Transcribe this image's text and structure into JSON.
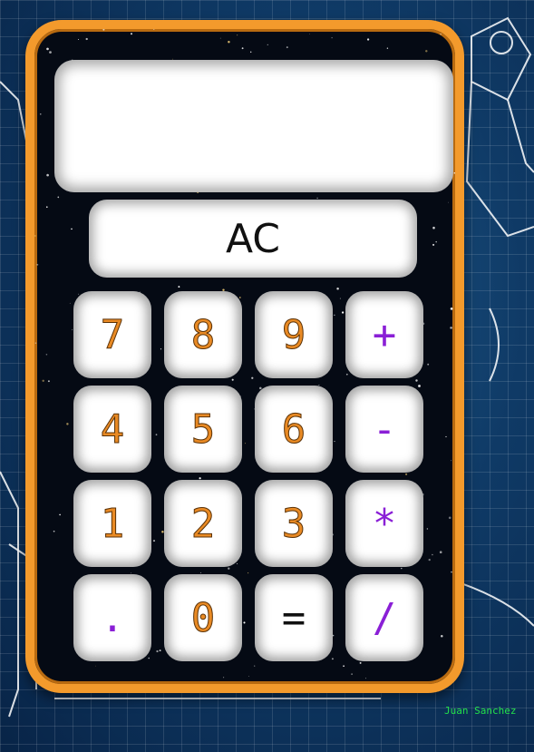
{
  "calculator": {
    "display_value": "",
    "clear_label": "AC",
    "keys": [
      {
        "label": "7",
        "kind": "num"
      },
      {
        "label": "8",
        "kind": "num"
      },
      {
        "label": "9",
        "kind": "num"
      },
      {
        "label": "+",
        "kind": "op"
      },
      {
        "label": "4",
        "kind": "num"
      },
      {
        "label": "5",
        "kind": "num"
      },
      {
        "label": "6",
        "kind": "num"
      },
      {
        "label": "-",
        "kind": "op"
      },
      {
        "label": "1",
        "kind": "num"
      },
      {
        "label": "2",
        "kind": "num"
      },
      {
        "label": "3",
        "kind": "num"
      },
      {
        "label": "*",
        "kind": "op"
      },
      {
        "label": ".",
        "kind": "op"
      },
      {
        "label": "0",
        "kind": "num"
      },
      {
        "label": "=",
        "kind": "eq"
      },
      {
        "label": "/",
        "kind": "op"
      }
    ]
  },
  "credit": "Juan Sanchez",
  "colors": {
    "frame": "#f39a2c",
    "digit": "#e98a24",
    "operator": "#8a1fd6",
    "credit": "#22e04a"
  }
}
